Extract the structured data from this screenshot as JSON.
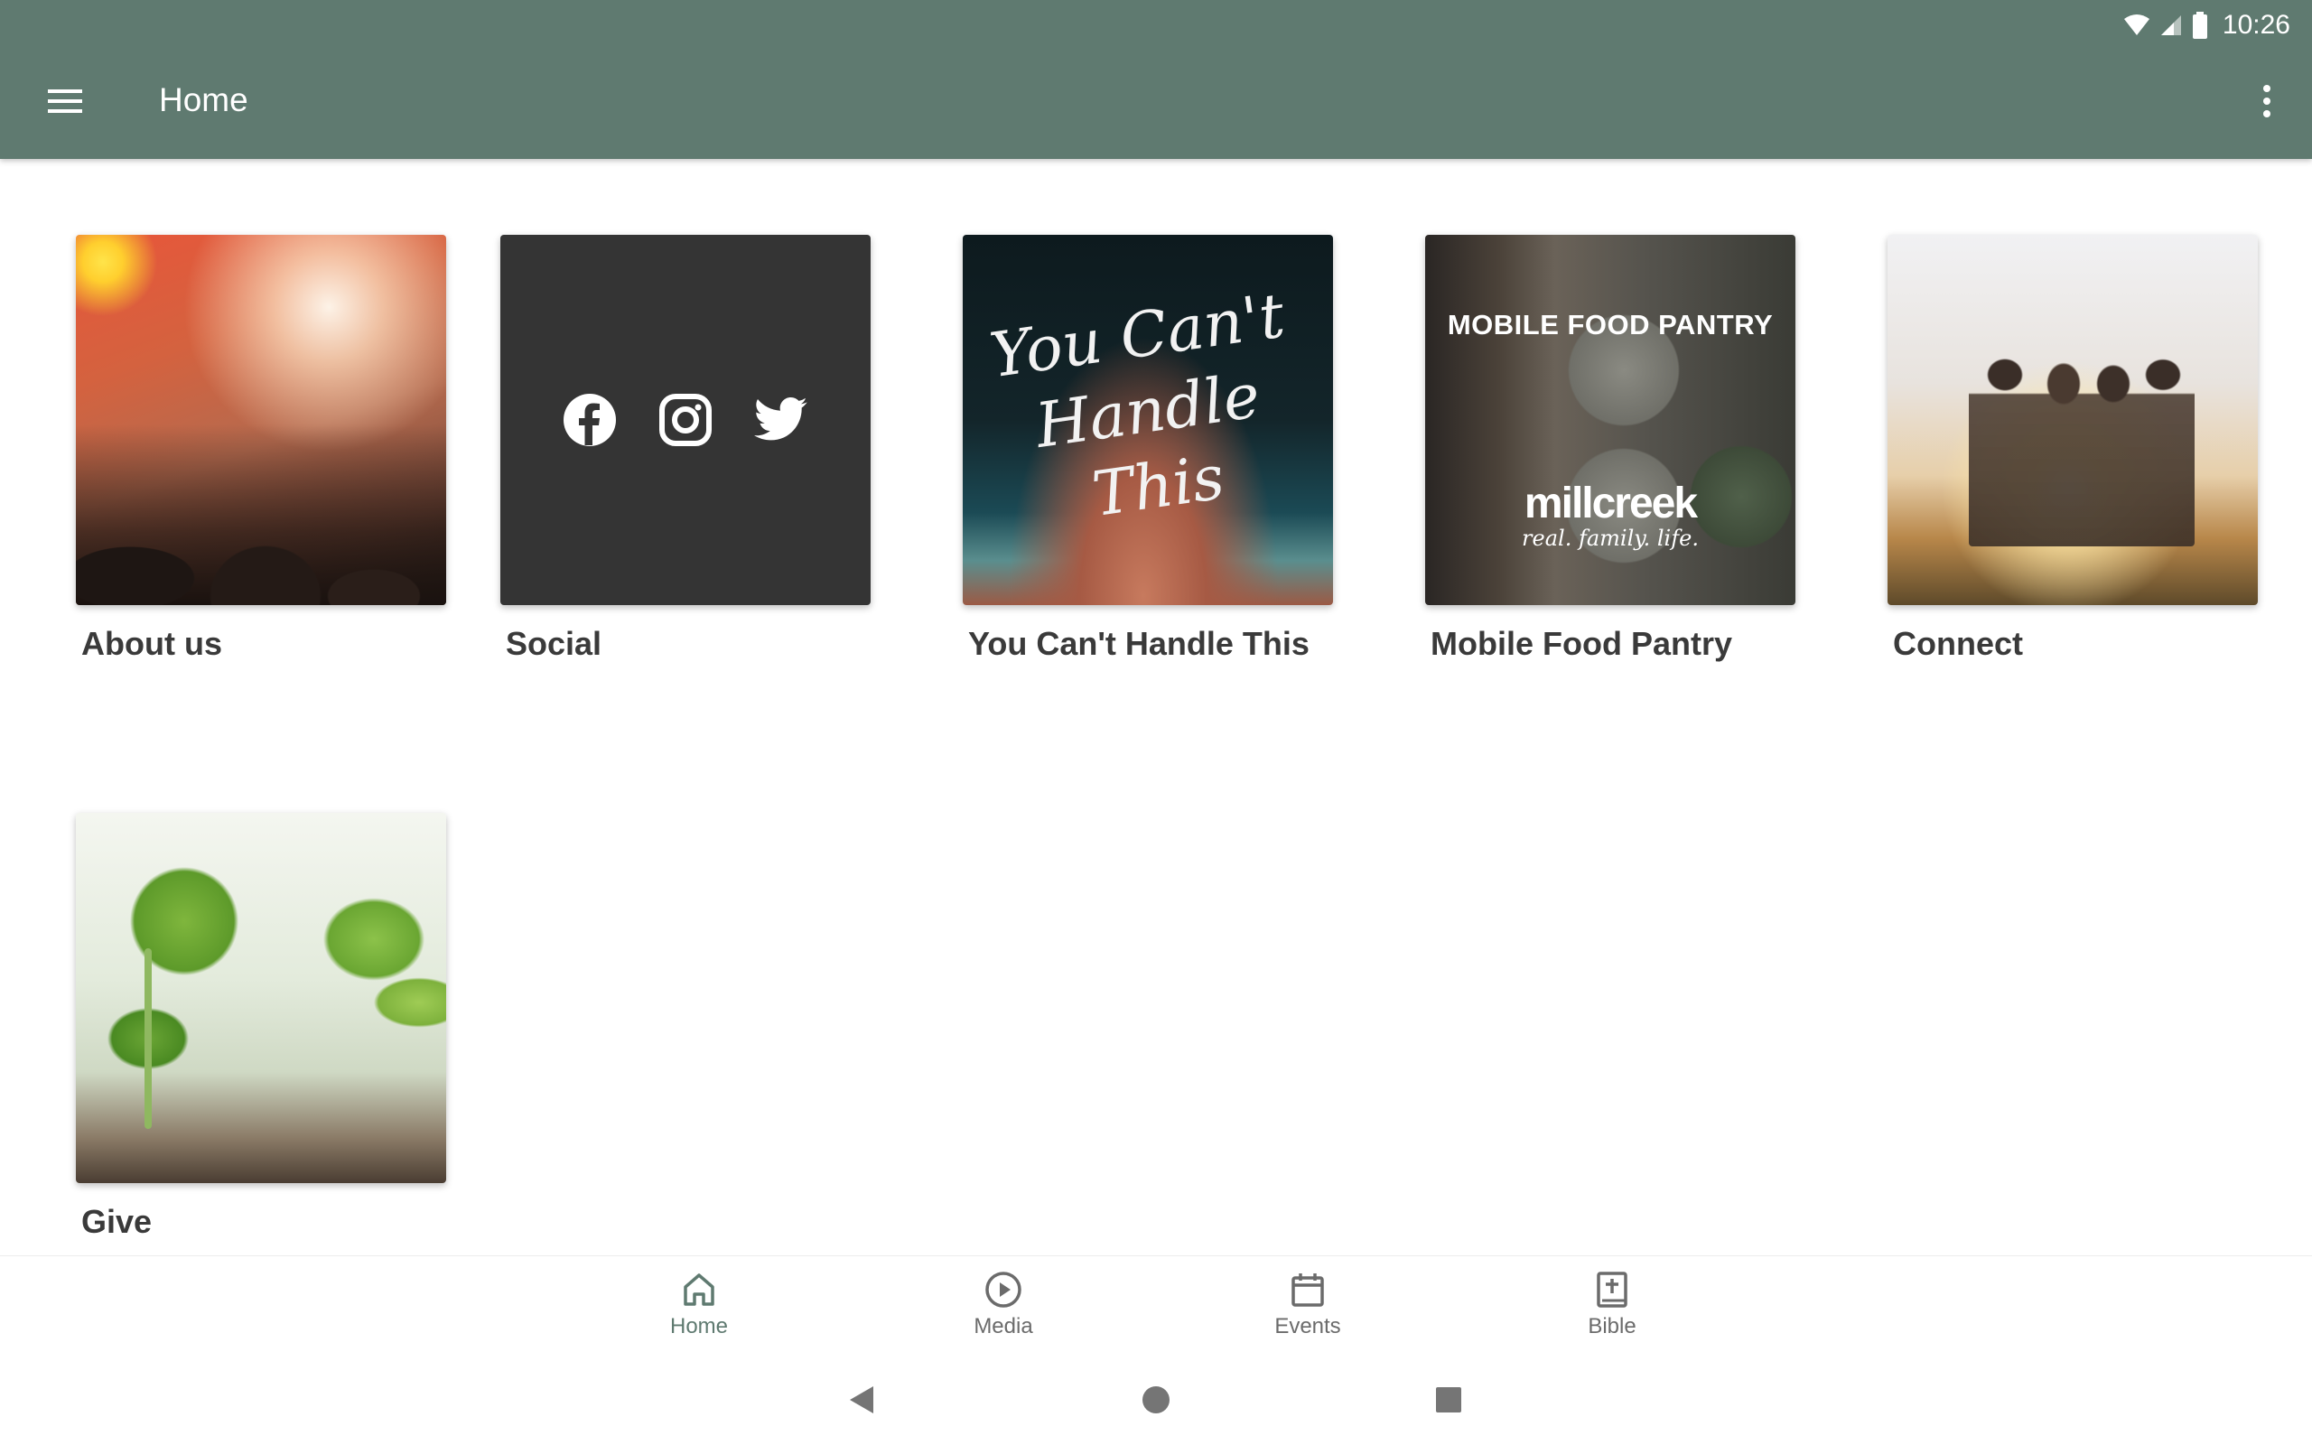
{
  "status_bar": {
    "time": "10:26"
  },
  "toolbar": {
    "title": "Home"
  },
  "tiles": [
    {
      "label": "About us"
    },
    {
      "label": "Social"
    },
    {
      "label": "You Can't Handle This",
      "art_text_line1": "You Can't",
      "art_text_line2": "Handle This"
    },
    {
      "label": "Mobile Food Pantry",
      "art_headline": "MOBILE FOOD PANTRY",
      "art_logo": "millcreek",
      "art_tagline": "real. family. life."
    },
    {
      "label": "Connect"
    },
    {
      "label": "Give"
    }
  ],
  "bottom_nav": {
    "items": [
      {
        "label": "Home",
        "icon": "home-icon",
        "active": true
      },
      {
        "label": "Media",
        "icon": "play-circle-icon"
      },
      {
        "label": "Events",
        "icon": "calendar-icon"
      },
      {
        "label": "Bible",
        "icon": "bible-icon"
      }
    ]
  },
  "colors": {
    "app_bar": "#5f7a70",
    "social_tile": "#343434",
    "active_nav": "#5f7a70"
  }
}
